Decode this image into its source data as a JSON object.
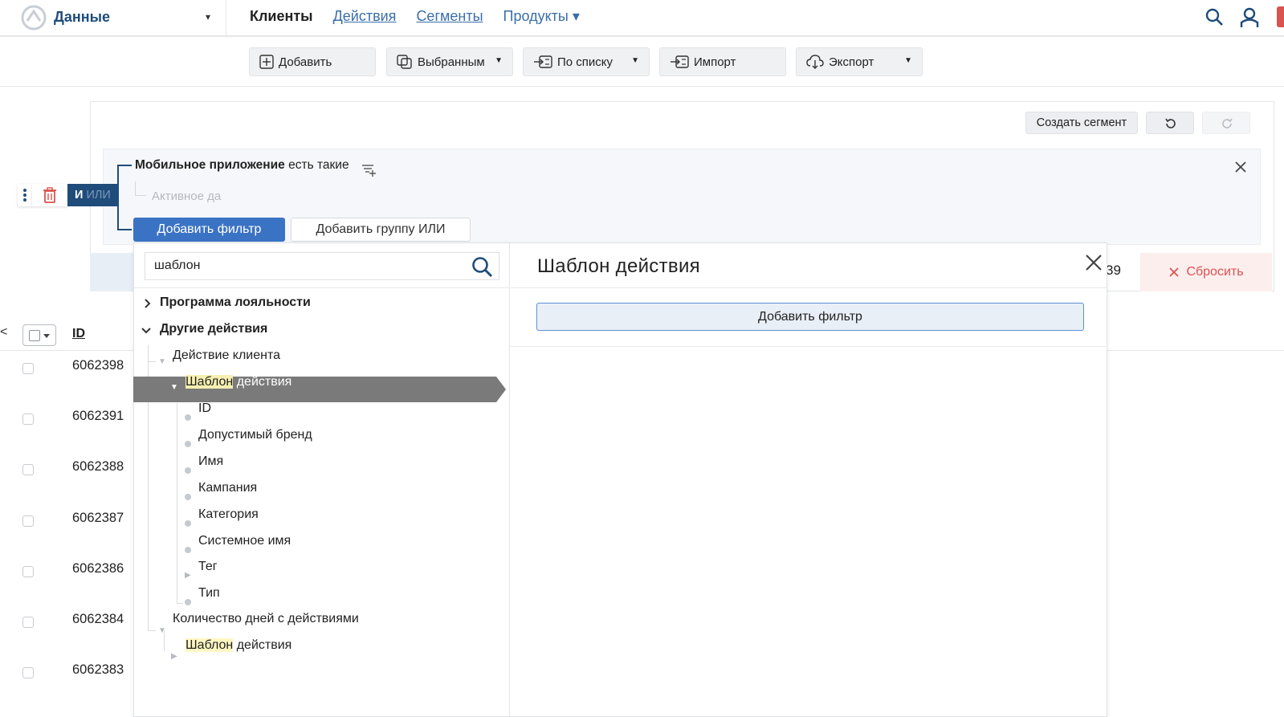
{
  "brand": {
    "name": "Данные",
    "caret": "▾"
  },
  "nav": {
    "clients": "Клиенты",
    "actions": "Действия",
    "segments": "Сегменты",
    "products": "Продукты ▾"
  },
  "toolbar": {
    "add": "Добавить",
    "selected": "Выбранным",
    "by_list": "По списку",
    "import": "Импорт",
    "export": "Экспорт",
    "dd": "▼"
  },
  "segment": {
    "create": "Создать сегмент"
  },
  "condition": {
    "title_bold": "Мобильное приложение",
    "title_rest": " есть такие",
    "sub": "Активное да",
    "and": "И",
    "or": " ИЛИ"
  },
  "buttons": {
    "add_filter": "Добавить фильтр",
    "add_group_or": "Добавить группу ИЛИ",
    "reset": "Сбросить"
  },
  "strip": {
    "count": "39"
  },
  "table": {
    "lt": "<",
    "id_header": "ID",
    "rows": [
      "6062398",
      "6062391",
      "6062388",
      "6062387",
      "6062386",
      "6062384",
      "6062383"
    ]
  },
  "search": {
    "value": "шаблон"
  },
  "tree": {
    "loyalty": "Программа лояльности",
    "other": "Другие действия",
    "client_action": "Действие клиента",
    "template_hl": "Шаблон",
    "template_rest": " действия",
    "fields": [
      "ID",
      "Допустимый бренд",
      "Имя",
      "Кампания",
      "Категория",
      "Системное имя",
      "Тег",
      "Тип"
    ],
    "days_count": "Количество дней с действиями",
    "template2_hl": "Шаблон",
    "template2_rest": " действия"
  },
  "detail": {
    "title": "Шаблон действия",
    "add_filter": "Добавить фильтр"
  }
}
